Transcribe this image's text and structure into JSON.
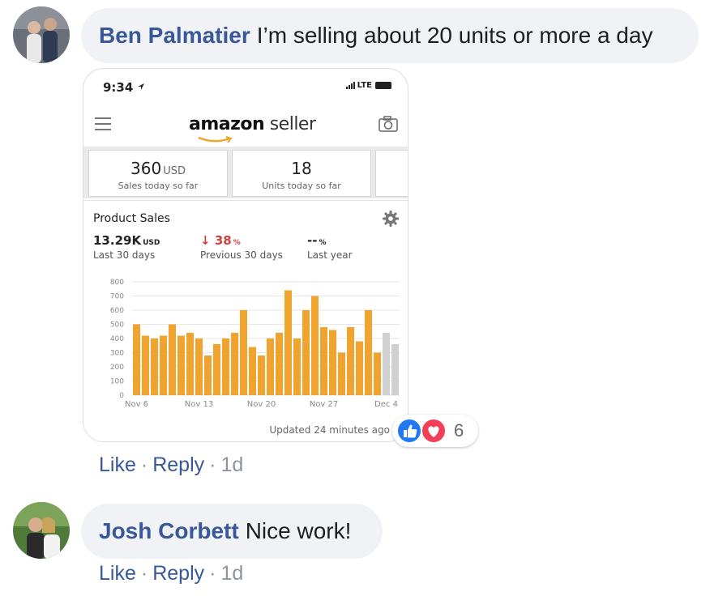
{
  "comments": [
    {
      "author": "Ben Palmatier",
      "text": "I’m selling about 20 units or more a day",
      "actions": {
        "like": "Like",
        "reply": "Reply",
        "time": "1d"
      },
      "reactions": {
        "types": [
          "like-icon",
          "love-icon"
        ],
        "count": "6"
      },
      "attachment": {
        "status_bar": {
          "time": "9:34",
          "network": "LTE"
        },
        "brand": {
          "word1": "amazon",
          "word2": "seller"
        },
        "tiles": [
          {
            "value": "360",
            "unit": "USD",
            "label": "Sales today so far"
          },
          {
            "value": "18",
            "unit": "",
            "label": "Units today so far"
          }
        ],
        "panel": {
          "title": "Product Sales",
          "stats": [
            {
              "value": "13.29K",
              "unit": "USD",
              "label": "Last 30 days"
            },
            {
              "arrow": "↓",
              "value": "38",
              "unit": "%",
              "label": "Previous 30 days"
            },
            {
              "value": "--",
              "unit": "%",
              "label": "Last year"
            }
          ],
          "updated": "Updated 24 minutes ago"
        },
        "chart_data": {
          "type": "bar",
          "categories": [
            "Nov 6",
            "Nov 7",
            "Nov 8",
            "Nov 9",
            "Nov 10",
            "Nov 11",
            "Nov 12",
            "Nov 13",
            "Nov 14",
            "Nov 15",
            "Nov 16",
            "Nov 17",
            "Nov 18",
            "Nov 19",
            "Nov 20",
            "Nov 21",
            "Nov 22",
            "Nov 23",
            "Nov 24",
            "Nov 25",
            "Nov 26",
            "Nov 27",
            "Nov 28",
            "Nov 29",
            "Nov 30",
            "Dec 1",
            "Dec 2",
            "Dec 3",
            "Dec 4",
            "Dec 5"
          ],
          "values": [
            500,
            420,
            400,
            420,
            500,
            420,
            440,
            400,
            280,
            360,
            400,
            440,
            600,
            340,
            280,
            400,
            440,
            740,
            400,
            600,
            700,
            480,
            460,
            300,
            480,
            380,
            600,
            300,
            440,
            360
          ],
          "highlight_color": "#f0a42f",
          "muted_color": "#d0d0d0",
          "muted_from_index": 28,
          "x_tick_labels": [
            "Nov 6",
            "Nov 13",
            "Nov 20",
            "Nov 27",
            "Dec 4"
          ],
          "y_ticks": [
            0,
            100,
            200,
            300,
            400,
            500,
            600,
            700,
            800
          ],
          "ylim": [
            0,
            800
          ],
          "grid": true
        }
      }
    },
    {
      "author": "Josh Corbett",
      "text": "Nice work!",
      "actions": {
        "like": "Like",
        "reply": "Reply",
        "time": "1d"
      }
    }
  ]
}
